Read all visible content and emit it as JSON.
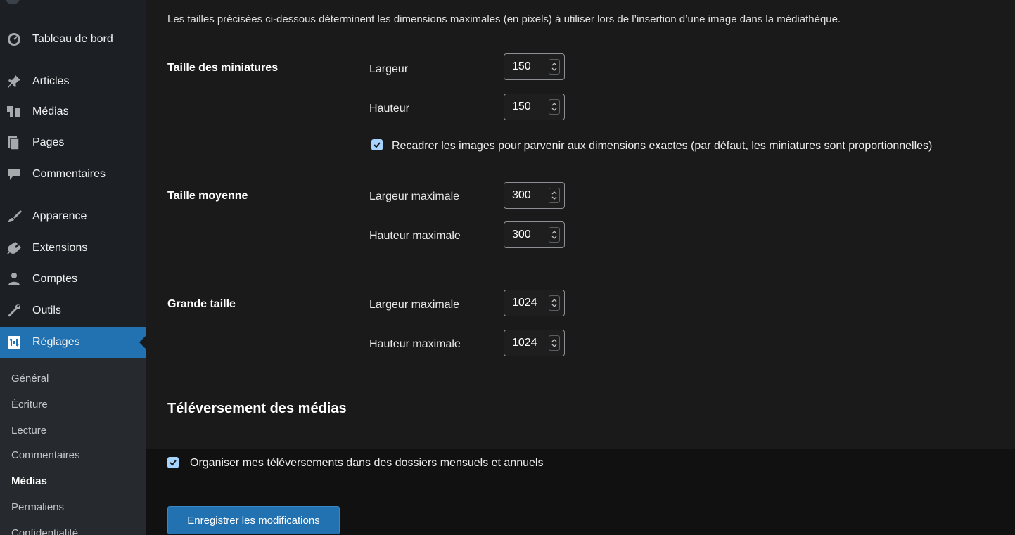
{
  "sidebar": {
    "items": [
      {
        "label": "Tableau de bord",
        "icon": "dashboard-icon"
      },
      {
        "label": "Articles",
        "icon": "pin-icon"
      },
      {
        "label": "Médias",
        "icon": "media-icon"
      },
      {
        "label": "Pages",
        "icon": "pages-icon"
      },
      {
        "label": "Commentaires",
        "icon": "comment-icon"
      },
      {
        "label": "Apparence",
        "icon": "brush-icon"
      },
      {
        "label": "Extensions",
        "icon": "plugin-icon"
      },
      {
        "label": "Comptes",
        "icon": "users-icon"
      },
      {
        "label": "Outils",
        "icon": "wrench-icon"
      },
      {
        "label": "Réglages",
        "icon": "settings-icon",
        "active": true
      }
    ],
    "submenu": [
      {
        "label": "Général"
      },
      {
        "label": "Écriture"
      },
      {
        "label": "Lecture"
      },
      {
        "label": "Commentaires"
      },
      {
        "label": "Médias",
        "current": true
      },
      {
        "label": "Permaliens"
      },
      {
        "label": "Confidentialité"
      }
    ]
  },
  "main": {
    "description": "Les tailles précisées ci-dessous déterminent les dimensions maximales (en pixels) à utiliser lors de l’insertion d’une image dans la médiathèque.",
    "thumbnail": {
      "label": "Taille des miniatures",
      "width_label": "Largeur",
      "width_value": "150",
      "height_label": "Hauteur",
      "height_value": "150",
      "crop_label": "Recadrer les images pour parvenir aux dimensions exactes (par défaut, les miniatures sont proportionnelles)",
      "crop_checked": true
    },
    "medium": {
      "label": "Taille moyenne",
      "width_label": "Largeur maximale",
      "width_value": "300",
      "height_label": "Hauteur maximale",
      "height_value": "300"
    },
    "large": {
      "label": "Grande taille",
      "width_label": "Largeur maximale",
      "width_value": "1024",
      "height_label": "Hauteur maximale",
      "height_value": "1024"
    },
    "uploads": {
      "title": "Téléversement des médias",
      "organize_label": "Organiser mes téléversements dans des dossiers mensuels et annuels",
      "organize_checked": true
    },
    "save_label": "Enregistrer les modifications"
  },
  "colors": {
    "accent": "#2271b1",
    "sidebar_bg": "#1c2025",
    "content_bg": "#1a1a1a",
    "checkbox": "#a7d3ff"
  }
}
